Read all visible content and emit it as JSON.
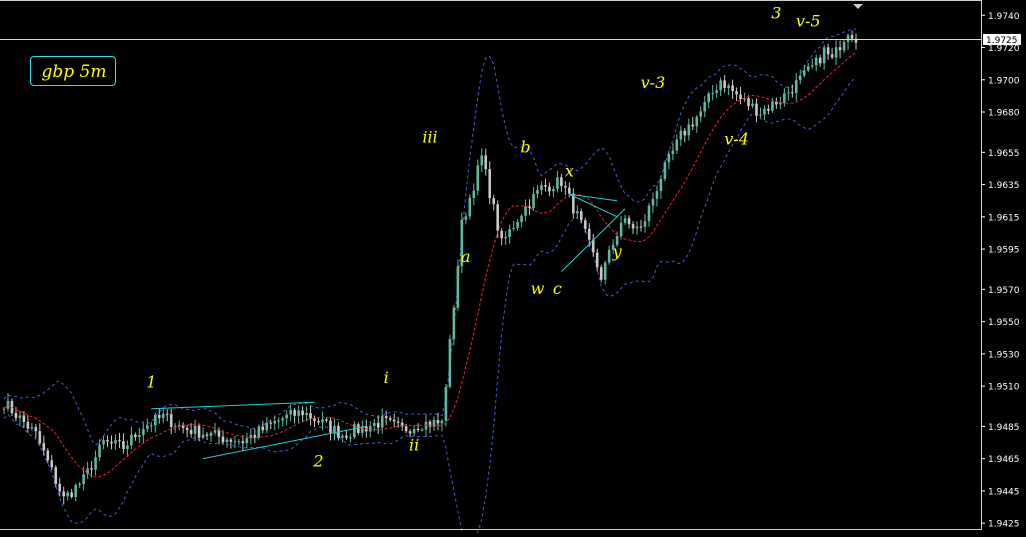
{
  "symbol_label": "gbp 5m",
  "colors": {
    "background": "#000000",
    "bull_bar": "#5fb8a0",
    "bear_bar": "#c8c8c8",
    "moving_average": "#ff2020",
    "bands": "#4060e0",
    "trendlines": "#20d0d0",
    "labels": "#ffff00",
    "axis": "#ffffff"
  },
  "chart_data": {
    "type": "line",
    "title": "",
    "y_ticks": [
      "1.9740",
      "1.9720",
      "1.9700",
      "1.9680",
      "1.9655",
      "1.9635",
      "1.9615",
      "1.9595",
      "1.9570",
      "1.9550",
      "1.9530",
      "1.9510",
      "1.9485",
      "1.9465",
      "1.9445",
      "1.9425"
    ],
    "ylim": [
      1.9422,
      1.9747
    ],
    "current_price": "1.9725",
    "bar_count": 215,
    "series": [
      {
        "role": "close",
        "x": [
          0,
          8,
          15,
          20,
          25,
          30,
          35,
          40,
          45,
          55,
          60,
          70,
          75,
          80,
          85,
          90,
          95,
          100,
          105,
          110,
          115,
          120,
          125,
          130,
          135,
          140,
          145,
          150,
          155,
          160,
          165,
          170,
          175,
          180,
          185,
          190,
          195,
          200,
          204,
          206,
          208,
          210,
          212,
          215
        ],
        "values": [
          1.95,
          1.948,
          1.944,
          1.9452,
          1.9475,
          1.9472,
          1.9485,
          1.9491,
          1.9484,
          1.9478,
          1.9476,
          1.949,
          1.9494,
          1.9487,
          1.948,
          1.9484,
          1.9488,
          1.9483,
          1.9487,
          1.9487,
          1.961,
          1.9652,
          1.9598,
          1.9618,
          1.9633,
          1.9637,
          1.961,
          1.9578,
          1.9612,
          1.9607,
          1.964,
          1.9665,
          1.968,
          1.97,
          1.9688,
          1.968,
          1.9688,
          1.97,
          1.971,
          1.9718,
          1.9712,
          1.9722,
          1.9731,
          1.9724
        ]
      },
      {
        "role": "moving_average"
      },
      {
        "role": "upper_band"
      },
      {
        "role": "lower_band"
      }
    ],
    "annotations": [
      {
        "text": "1",
        "x": 37,
        "price": 1.9509
      },
      {
        "text": "2",
        "x": 79,
        "price": 1.946
      },
      {
        "text": "i",
        "x": 96,
        "price": 1.9512
      },
      {
        "text": "ii",
        "x": 103,
        "price": 1.947
      },
      {
        "text": "iii",
        "x": 107,
        "price": 1.9661
      },
      {
        "text": "a",
        "x": 116,
        "price": 1.9587
      },
      {
        "text": "b",
        "x": 131,
        "price": 1.9655
      },
      {
        "text": "x",
        "x": 142,
        "price": 1.964
      },
      {
        "text": "w",
        "x": 134,
        "price": 1.9567
      },
      {
        "text": "c",
        "x": 139,
        "price": 1.9567
      },
      {
        "text": "y",
        "x": 154,
        "price": 1.959
      },
      {
        "text": "v-3",
        "x": 163,
        "price": 1.9695
      },
      {
        "text": "v-4",
        "x": 184,
        "price": 1.966
      },
      {
        "text": "3",
        "x": 194,
        "price": 1.9738
      },
      {
        "text": "v-5",
        "x": 202,
        "price": 1.9733
      }
    ],
    "trendlines": [
      {
        "from": [
          37,
          1.9496
        ],
        "to": [
          78,
          1.95
        ]
      },
      {
        "from": [
          50,
          1.9465
        ],
        "to": [
          91,
          1.9485
        ]
      },
      {
        "from": [
          142,
          1.9629
        ],
        "to": [
          154,
          1.9625
        ]
      },
      {
        "from": [
          142,
          1.9629
        ],
        "to": [
          154,
          1.9615
        ]
      },
      {
        "from": [
          140,
          1.9581
        ],
        "to": [
          156,
          1.962
        ]
      }
    ]
  }
}
